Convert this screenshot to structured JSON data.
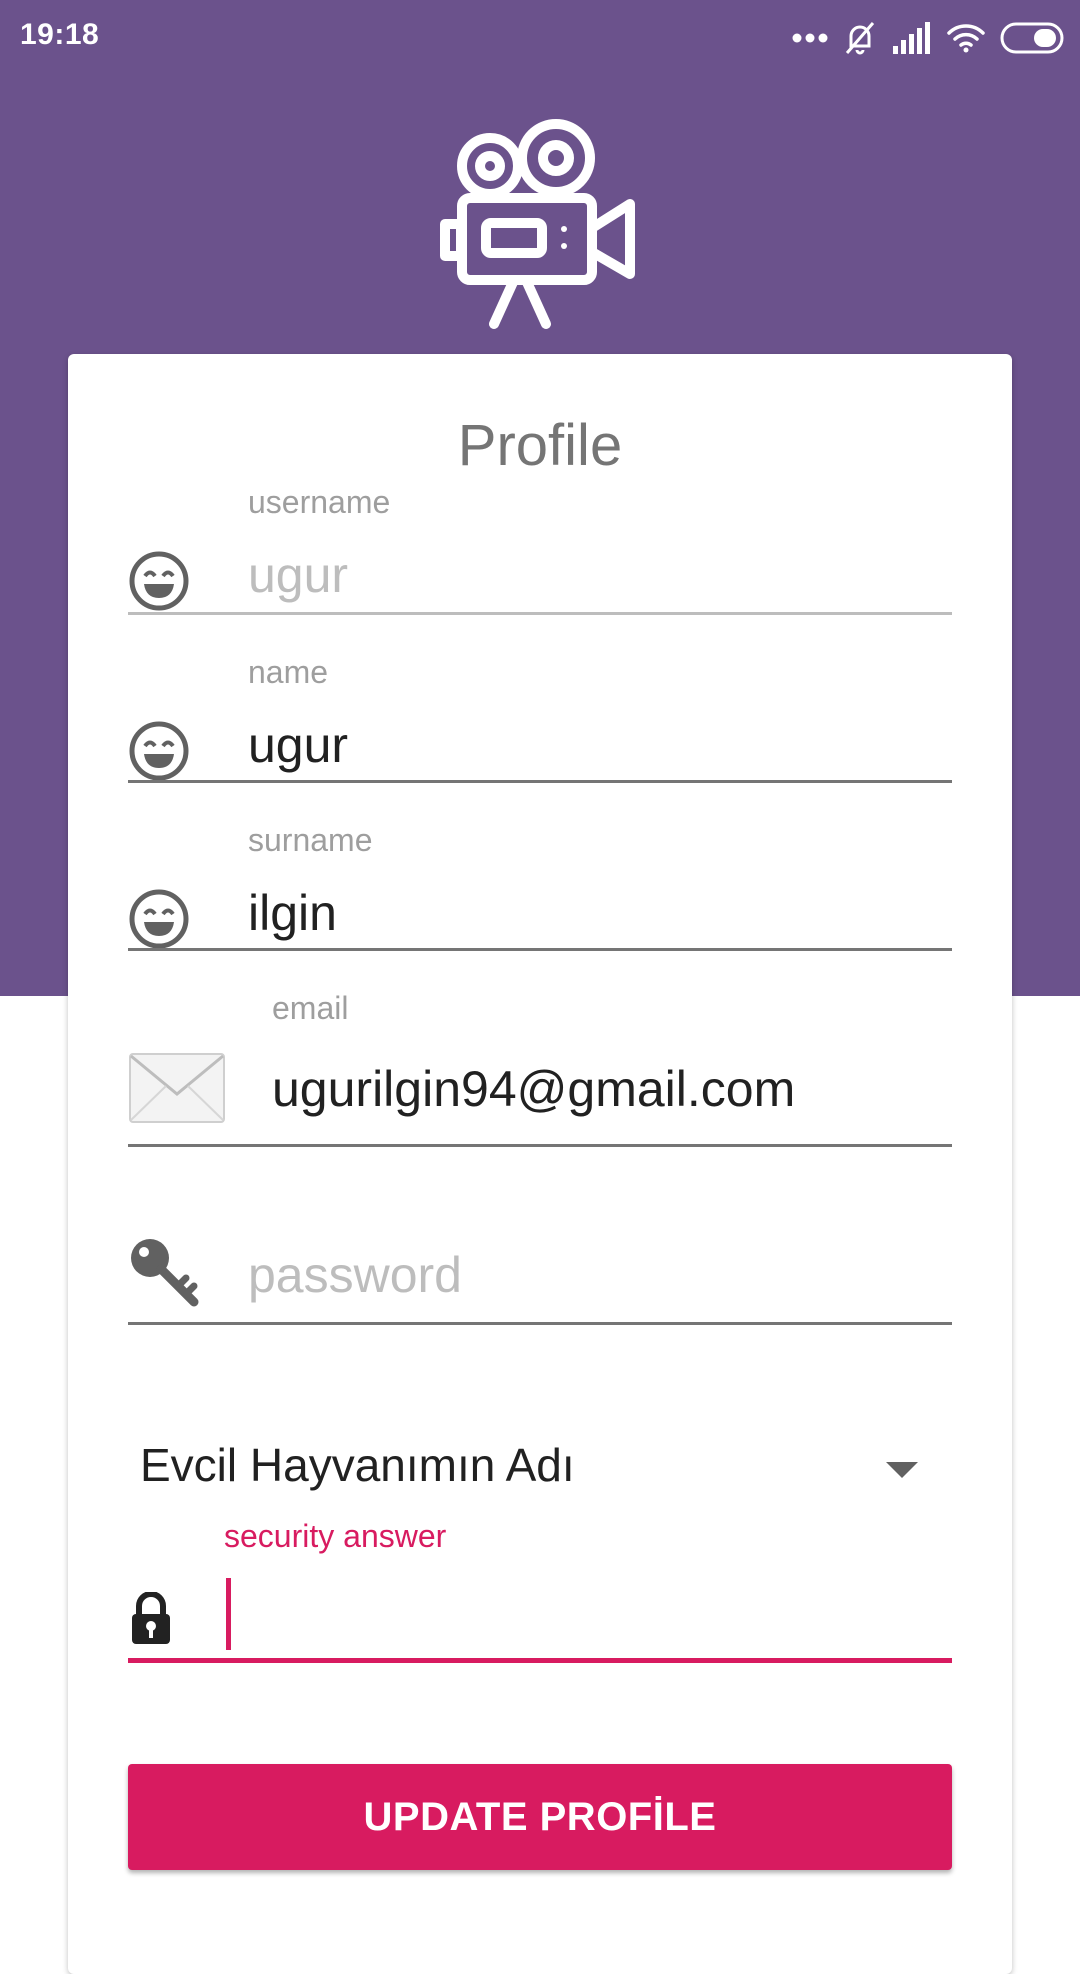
{
  "status_bar": {
    "time": "19:18",
    "icons": [
      "more-dots-icon",
      "mute-alarm-icon",
      "signal-icon",
      "wifi-icon",
      "battery-icon"
    ]
  },
  "app": {
    "logo_icon": "movie-camera-icon",
    "colors": {
      "primary": "#6b528c",
      "accent": "#d81b60"
    }
  },
  "profile": {
    "title": "Profile",
    "fields": [
      {
        "label": "username",
        "value": "ugur",
        "icon": "smile-icon",
        "enabled": false
      },
      {
        "label": "name",
        "value": "ugur",
        "icon": "smile-icon"
      },
      {
        "label": "surname",
        "value": "ilgin",
        "icon": "smile-icon"
      },
      {
        "label": "email",
        "value": "ugurilgin94@gmail.com",
        "icon": "envelope-icon"
      },
      {
        "placeholder": "password",
        "value": "",
        "icon": "key-icon"
      }
    ],
    "security_question": {
      "selected": "Evcil Hayvanımın Adı"
    },
    "security_answer": {
      "label": "security answer",
      "value": "",
      "icon": "lock-icon"
    },
    "update_button": "UPDATE PROFİLE"
  }
}
